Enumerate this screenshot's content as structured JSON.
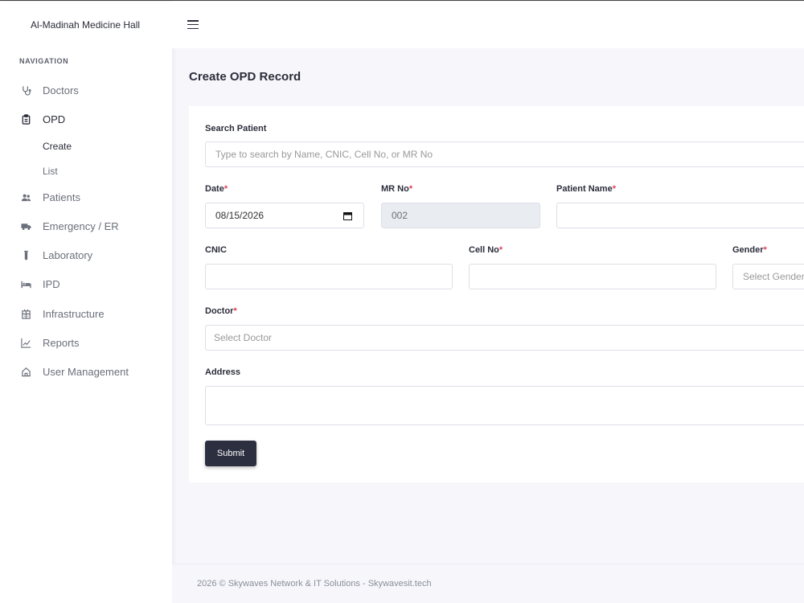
{
  "app": {
    "brand": "Al-Madinah Medicine Hall"
  },
  "sidebar": {
    "heading": "NAVIGATION",
    "items": [
      {
        "label": "Doctors",
        "icon": "stethoscope-icon"
      },
      {
        "label": "OPD",
        "icon": "clipboard-icon"
      },
      {
        "label": "Patients",
        "icon": "users-icon"
      },
      {
        "label": "Emergency / ER",
        "icon": "ambulance-icon"
      },
      {
        "label": "Laboratory",
        "icon": "test-tube-icon"
      },
      {
        "label": "IPD",
        "icon": "bed-icon"
      },
      {
        "label": "Infrastructure",
        "icon": "building-icon"
      },
      {
        "label": "Reports",
        "icon": "chart-line-icon"
      },
      {
        "label": "User Management",
        "icon": "home-icon"
      }
    ],
    "opd_sub": [
      {
        "label": "Create"
      },
      {
        "label": "List"
      }
    ],
    "active_item": "OPD",
    "active_sub": "Create"
  },
  "page": {
    "title": "Create OPD Record"
  },
  "form": {
    "search_label": "Search Patient",
    "search_placeholder": "Type to search by Name, CNIC, Cell No, or MR No",
    "date_label": "Date",
    "date_value": "08/15/2026",
    "mr_label": "MR No",
    "mr_value": "002",
    "patient_name_label": "Patient Name",
    "patient_name_value": "",
    "cnic_label": "CNIC",
    "cnic_value": "",
    "cell_label": "Cell No",
    "cell_value": "",
    "gender_label": "Gender",
    "gender_placeholder": "Select Gender",
    "doctor_label": "Doctor",
    "doctor_placeholder": "Select Doctor",
    "address_label": "Address",
    "address_value": "",
    "required_mark": "*",
    "submit_label": "Submit"
  },
  "footer": {
    "text": "2026 © Skywaves Network & IT Solutions - Skywavesit.tech"
  },
  "colors": {
    "accent": "#2c2f3f",
    "required": "#e0405a",
    "background": "#f7f7fb"
  }
}
